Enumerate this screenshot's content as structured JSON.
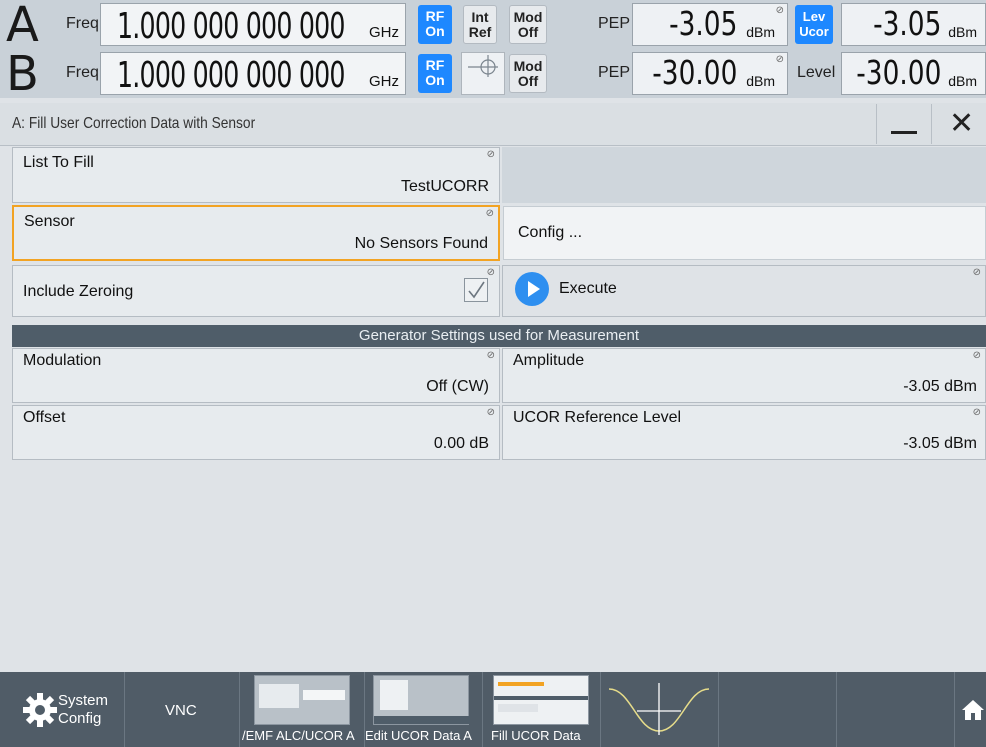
{
  "status": {
    "a": {
      "letter": "A",
      "freq_label": "Freq",
      "freq_value": "1.000 000 000 000",
      "freq_unit": "GHz",
      "rf": "RF\nOn",
      "ref": "Int\nRef",
      "mod": "Mod\nOff",
      "pep_label": "PEP",
      "pep_value": "-3.05",
      "pep_unit": "dBm",
      "mode_badge": "Lev\nUcor",
      "level_value": "-3.05",
      "level_unit": "dBm"
    },
    "b": {
      "letter": "B",
      "freq_label": "Freq",
      "freq_value": "1.000 000 000 000",
      "freq_unit": "GHz",
      "rf": "RF\nOn",
      "mod": "Mod\nOff",
      "pep_label": "PEP",
      "pep_value": "-30.00",
      "pep_unit": "dBm",
      "level_label": "Level",
      "level_value": "-30.00",
      "level_unit": "dBm"
    }
  },
  "dialog": {
    "title": "A: Fill User Correction Data with Sensor",
    "list_to_fill": {
      "label": "List To Fill",
      "value": "TestUCORR"
    },
    "sensor": {
      "label": "Sensor",
      "value": "No Sensors Found"
    },
    "config_button": "Config ...",
    "include_zeroing": {
      "label": "Include Zeroing",
      "checked": true
    },
    "execute_button": "Execute",
    "section_title": "Generator Settings used for Measurement",
    "modulation": {
      "label": "Modulation",
      "value": "Off (CW)"
    },
    "amplitude": {
      "label": "Amplitude",
      "value": "-3.05 dBm"
    },
    "offset": {
      "label": "Offset",
      "value": "0.00 dB"
    },
    "ucor_ref": {
      "label": "UCOR Reference Level",
      "value": "-3.05 dBm"
    }
  },
  "taskbar": {
    "system_config": "System\nConfig",
    "vnc": "VNC",
    "tasks": [
      "/EMF ALC/UCOR A",
      "Edit UCOR  Data A",
      "Fill UCOR  Data"
    ]
  },
  "colors": {
    "accent_blue": "#1e88ff",
    "focus": "#f2a323",
    "taskbar": "#505c67"
  }
}
